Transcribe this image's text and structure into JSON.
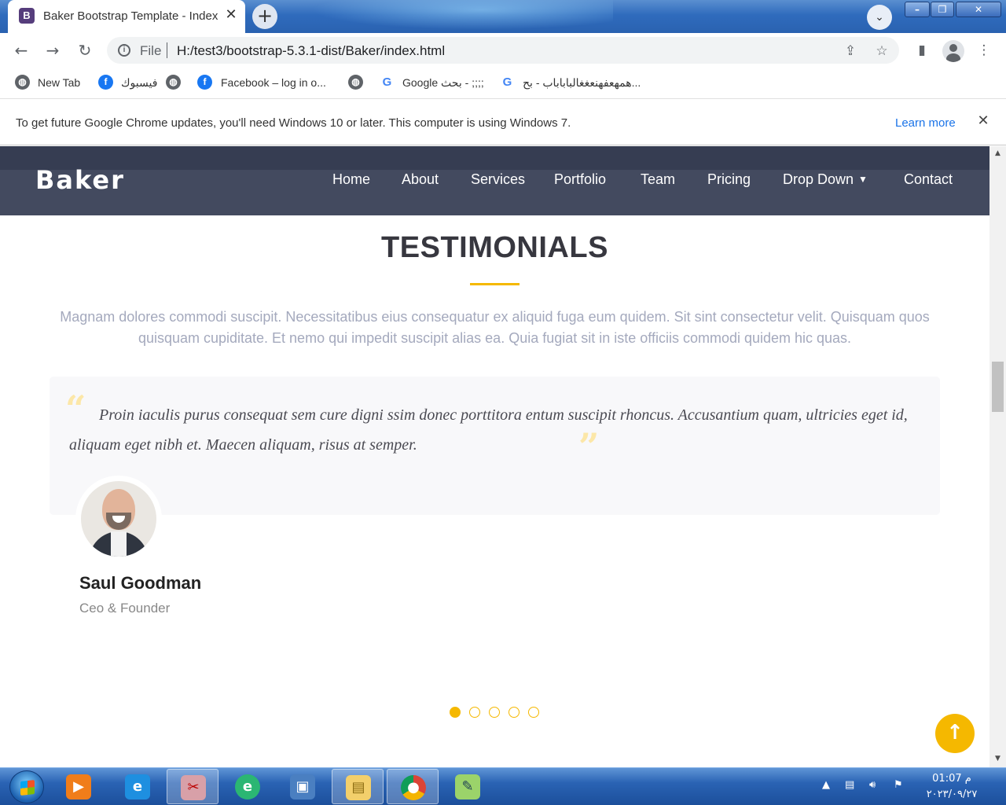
{
  "browser": {
    "tab_title": "Baker Bootstrap Template - Index",
    "tab_favicon_letter": "B",
    "url_scheme": "File",
    "url": "H:/test3/bootstrap-5.3.1-dist/Baker/index.html",
    "bookmarks": [
      {
        "label": "New Tab",
        "icon": "globe-icon"
      },
      {
        "label": "فيسبوك",
        "icon": "facebook-icon"
      },
      {
        "label": "",
        "icon": "globe-icon"
      },
      {
        "label": "Facebook – log in o...",
        "icon": "facebook-icon"
      },
      {
        "label": "",
        "icon": "globe-icon"
      },
      {
        "label": "Google بحث - ;;;;",
        "icon": "google-icon"
      },
      {
        "label": "همهعفهنعغغالباباباب - بح...",
        "icon": "google-icon"
      }
    ],
    "infobar": {
      "message": "To get future Google Chrome updates, you'll need Windows 10 or later. This computer is using Windows 7.",
      "link": "Learn more"
    }
  },
  "site": {
    "logo": "Baker",
    "nav": [
      "Home",
      "About",
      "Services",
      "Portfolio",
      "Team",
      "Pricing",
      "Drop Down",
      "Contact"
    ],
    "section": {
      "title": "TESTIMONIALS",
      "description": "Magnam dolores commodi suscipit. Necessitatibus eius consequatur ex aliquid fuga eum quidem. Sit sint consectetur velit. Quisquam quos quisquam cupiditate. Et nemo qui impedit suscipit alias ea. Quia fugiat sit in iste officiis commodi quidem hic quas."
    },
    "testimonial": {
      "quote": "Proin iaculis purus consequat sem cure digni ssim donec porttitora entum suscipit rhoncus. Accusantium quam, ultricies eget id, aliquam eget nibh et. Maecen aliquam, risus at semper.",
      "name": "Saul Goodman",
      "role": "Ceo & Founder"
    },
    "pagination": {
      "count": 5,
      "active_index": 0
    },
    "accent_color": "#f5b800"
  },
  "taskbar": {
    "apps": [
      "media-player-icon",
      "internet-explorer-icon",
      "snipping-tool-icon",
      "edge-icon",
      "network-icon",
      "file-explorer-icon",
      "chrome-icon",
      "notepad-icon"
    ],
    "active_app": "chrome-icon",
    "time": "01:07 م",
    "date": "٢٠٢٣/٠٩/٢٧"
  }
}
